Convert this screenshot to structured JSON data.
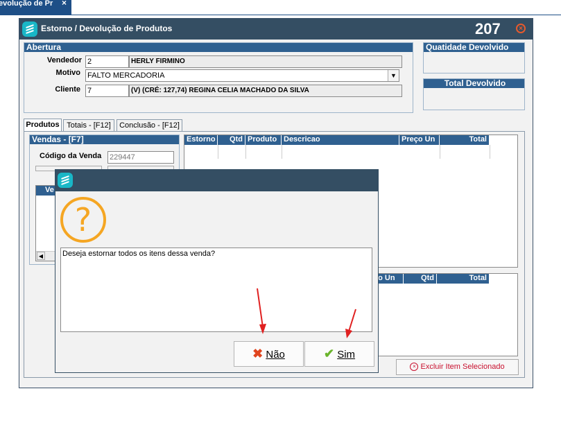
{
  "top_tab": {
    "label": "evolução de Pr",
    "close": "×"
  },
  "window": {
    "title": "Estorno / Devolução de Produtos",
    "number": "207",
    "close": "⊗"
  },
  "abertura": {
    "header": "Abertura",
    "vendedor_label": "Vendedor",
    "vendedor_code": "2",
    "vendedor_name": "HERLY  FIRMINO",
    "motivo_label": "Motivo",
    "motivo_value": "FALTO MERCADORIA",
    "cliente_label": "Cliente",
    "cliente_code": "7",
    "cliente_name": "(V) (CRÉ: 127,74) REGINA CELIA MACHADO DA SILVA"
  },
  "qtd_devolvido": {
    "header": "Quatidade Devolvido"
  },
  "total_devolvido": {
    "header": "Total Devolvido"
  },
  "tabs": [
    {
      "label": "Produtos"
    },
    {
      "label": "Totais - [F12]"
    },
    {
      "label": "Conclusão - [F12]"
    }
  ],
  "vendas": {
    "header": "Vendas - [F7]",
    "codigo_label": "Código da Venda",
    "codigo_value": "229447",
    "col_partial": "Ve"
  },
  "grid_top": {
    "columns": [
      "Estorno",
      "Qtd",
      "Produto",
      "Descricao",
      "Preço Un",
      "Total"
    ]
  },
  "grid_bottom": {
    "columns": [
      "ço Un",
      "Qtd",
      "Total"
    ]
  },
  "excluir_button": {
    "label": "Excluir Item Selecionado"
  },
  "dialog": {
    "message": "Deseja estornar todos os itens dessa venda?",
    "no_label": "Não",
    "yes_label": "Sim"
  },
  "colors": {
    "titlebar": "#344e63",
    "section": "#2f6090",
    "accent": "#19b7c7",
    "question": "#f5a623",
    "annotation_arrow": "#e02020"
  }
}
